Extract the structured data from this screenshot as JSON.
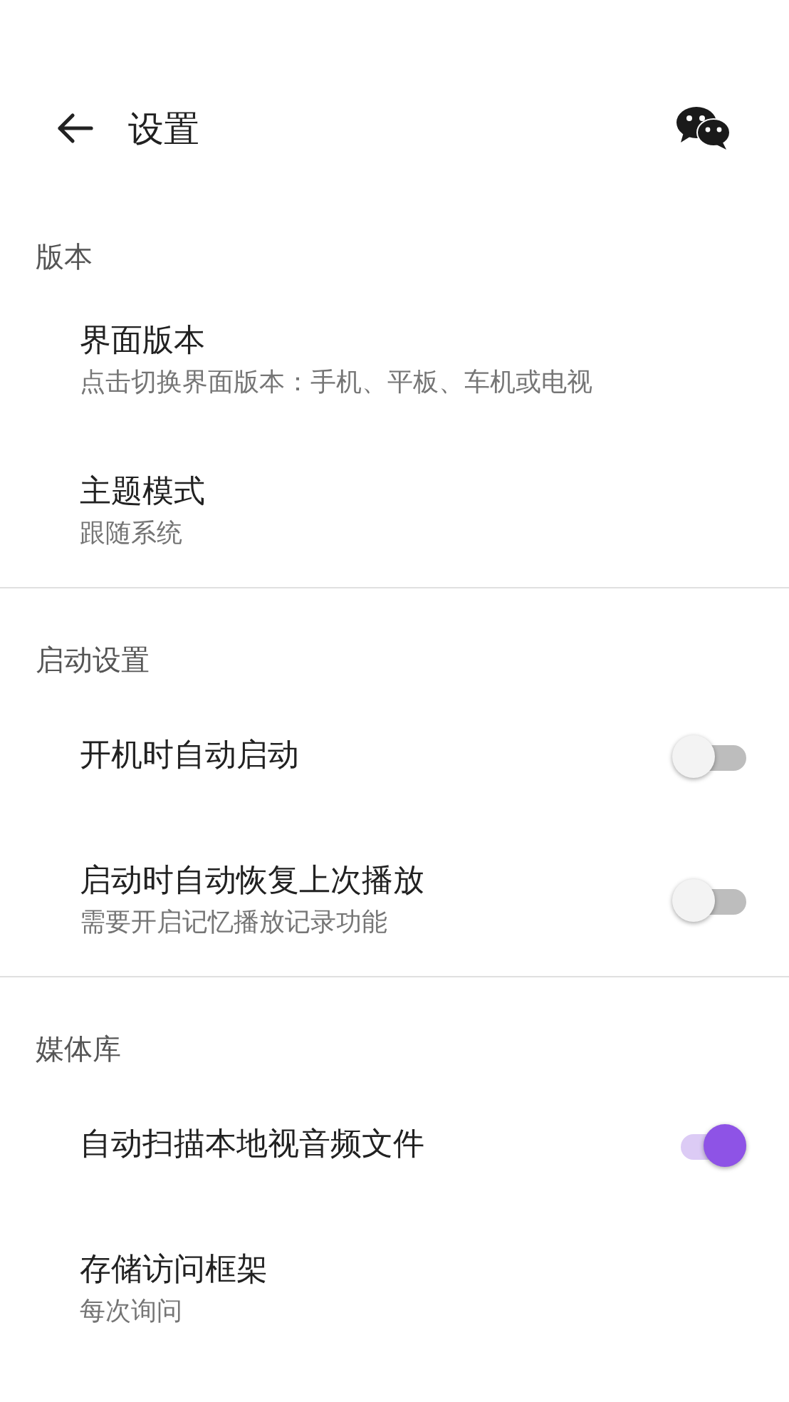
{
  "header": {
    "title": "设置"
  },
  "sections": [
    {
      "label": "版本",
      "items": [
        {
          "kind": "nav",
          "title": "界面版本",
          "subtitle": "点击切换界面版本：手机、平板、车机或电视"
        },
        {
          "kind": "nav",
          "title": "主题模式",
          "subtitle": "跟随系统"
        }
      ]
    },
    {
      "label": "启动设置",
      "items": [
        {
          "kind": "switch",
          "title": "开机时自动启动",
          "on": false
        },
        {
          "kind": "switch",
          "title": "启动时自动恢复上次播放",
          "subtitle": "需要开启记忆播放记录功能",
          "on": false
        }
      ]
    },
    {
      "label": "媒体库",
      "items": [
        {
          "kind": "switch",
          "title": "自动扫描本地视音频文件",
          "on": true
        },
        {
          "kind": "nav",
          "title": "存储访问框架",
          "subtitle": "每次询问"
        }
      ]
    }
  ]
}
